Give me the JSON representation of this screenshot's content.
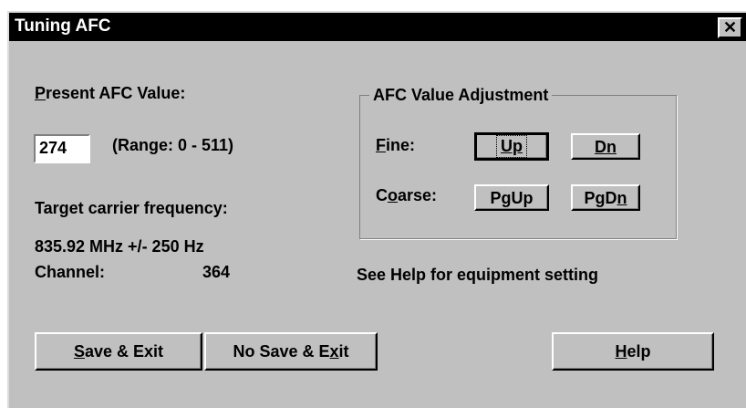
{
  "window": {
    "title": "Tuning AFC",
    "close_glyph": "✕"
  },
  "present_afc": {
    "label_first": "P",
    "label_rest": "resent AFC Value:",
    "value": "274",
    "range": "(Range: 0 - 511)"
  },
  "target": {
    "label": "Target carrier frequency:",
    "frequency": "835.92  MHz  +/- 250 Hz",
    "channel_label": "Channel:",
    "channel_value": "364"
  },
  "adjustment": {
    "group_title": "AFC Value Adjustment",
    "fine_first": "F",
    "fine_rest": "ine:",
    "coarse_a": "C",
    "coarse_u": "o",
    "coarse_b": "arse:",
    "up": "Up",
    "dn_a": "D",
    "dn_b": "n",
    "pgup_a": "P",
    "pgup_u": "g",
    "pgup_b": "Up",
    "pgdn_a": "Pg",
    "pgdn_b": "D",
    "pgdn_u": "n"
  },
  "help_note": "See Help for equipment setting",
  "buttons": {
    "save_u": "S",
    "save_rest": "ave & Exit",
    "nosave_a": "No Save & E",
    "nosave_u": "x",
    "nosave_b": "it",
    "help_u": "H",
    "help_rest": "elp"
  }
}
